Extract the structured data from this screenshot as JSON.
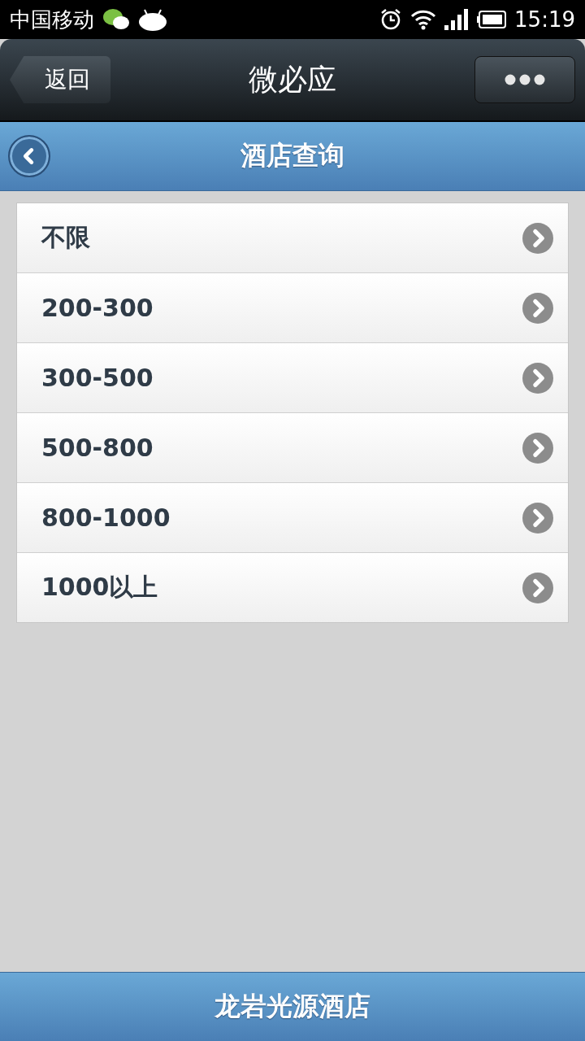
{
  "status_bar": {
    "carrier": "中国移动",
    "time": "15:19"
  },
  "nav_bar": {
    "back": "返回",
    "title": "微必应"
  },
  "header": {
    "title": "酒店查询"
  },
  "price_list": [
    {
      "label": "不限"
    },
    {
      "label": "200-300"
    },
    {
      "label": "300-500"
    },
    {
      "label": "500-800"
    },
    {
      "label": "800-1000"
    },
    {
      "label": "1000以上"
    }
  ],
  "footer": {
    "title": "龙岩光源酒店"
  }
}
